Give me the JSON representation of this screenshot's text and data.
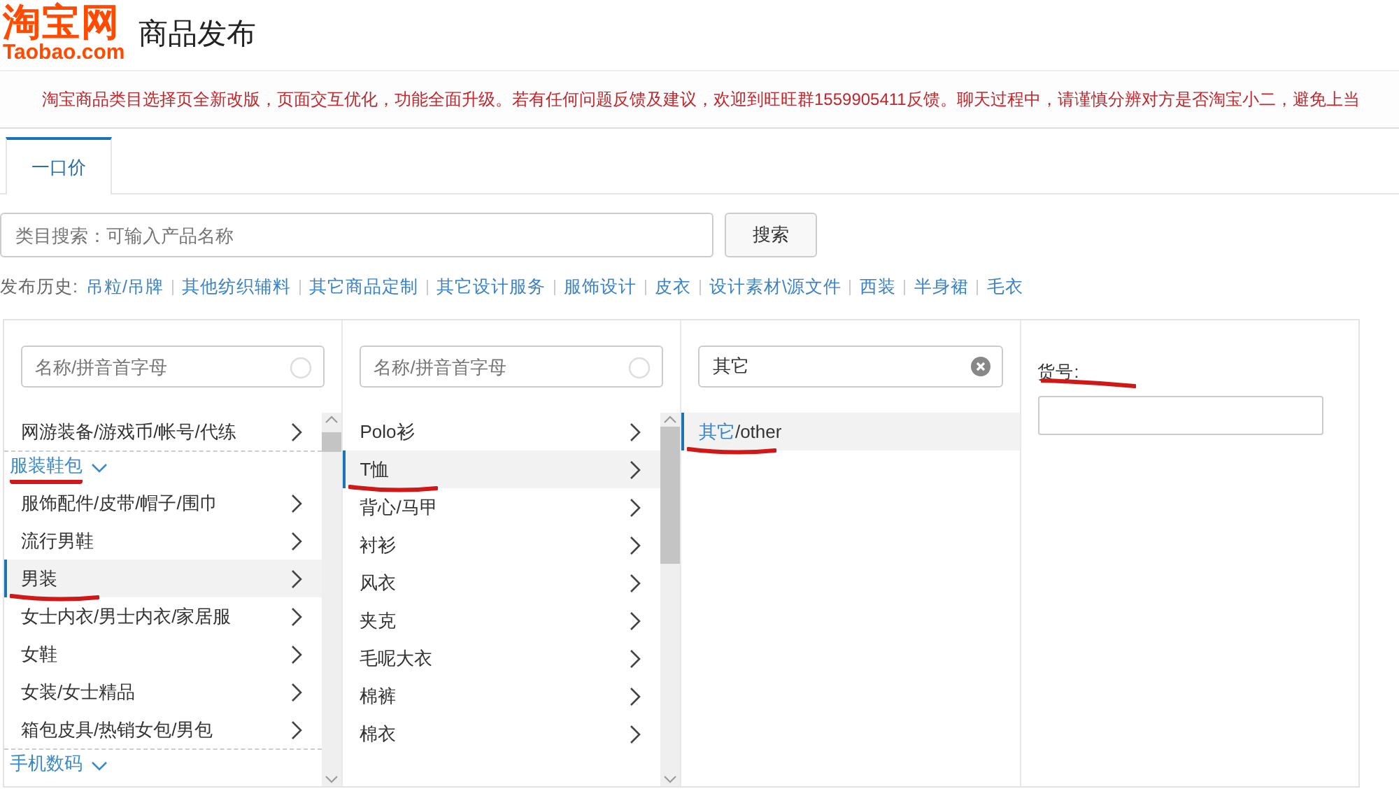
{
  "logo": {
    "mark": "淘宝网",
    "domain": "Taobao.com"
  },
  "page_title": "商品发布",
  "notice": "淘宝商品类目选择页全新改版，页面交互优化，功能全面升级。若有任何问题反馈及建议，欢迎到旺旺群1559905411反馈。聊天过程中，请谨慎分辨对方是否淘宝小二，避免上当",
  "tabs": [
    {
      "label": "一口价",
      "selected": true
    }
  ],
  "category_search": {
    "placeholder": "类目搜索：可输入产品名称",
    "button": "搜索"
  },
  "history": {
    "label": "发布历史:",
    "links": [
      "吊粒/吊牌",
      "其他纺织辅料",
      "其它商品定制",
      "其它设计服务",
      "服饰设计",
      "皮衣",
      "设计素材\\源文件",
      "西装",
      "半身裙",
      "毛衣"
    ]
  },
  "category_columns": [
    {
      "search": {
        "placeholder": "名称/拼音首字母"
      },
      "items": [
        {
          "kind": "item",
          "label": "网游装备/游戏币/帐号/代练",
          "selected": false,
          "annotated": false
        },
        {
          "kind": "group",
          "label": "服装鞋包",
          "annotated": true
        },
        {
          "kind": "item",
          "label": "服饰配件/皮带/帽子/围巾",
          "selected": false,
          "annotated": false
        },
        {
          "kind": "item",
          "label": "流行男鞋",
          "selected": false,
          "annotated": false
        },
        {
          "kind": "item",
          "label": "男装",
          "selected": true,
          "annotated": true
        },
        {
          "kind": "item",
          "label": "女士内衣/男士内衣/家居服",
          "selected": false,
          "annotated": false
        },
        {
          "kind": "item",
          "label": "女鞋",
          "selected": false,
          "annotated": false
        },
        {
          "kind": "item",
          "label": "女装/女士精品",
          "selected": false,
          "annotated": false
        },
        {
          "kind": "item",
          "label": "箱包皮具/热销女包/男包",
          "selected": false,
          "annotated": false
        },
        {
          "kind": "group",
          "label": "手机数码",
          "annotated": false
        }
      ]
    },
    {
      "search": {
        "placeholder": "名称/拼音首字母"
      },
      "items": [
        {
          "kind": "item",
          "label": "Polo衫",
          "selected": false,
          "annotated": false
        },
        {
          "kind": "item",
          "label": "T恤",
          "selected": true,
          "annotated": true
        },
        {
          "kind": "item",
          "label": "背心/马甲",
          "selected": false,
          "annotated": false
        },
        {
          "kind": "item",
          "label": "衬衫",
          "selected": false,
          "annotated": false
        },
        {
          "kind": "item",
          "label": "风衣",
          "selected": false,
          "annotated": false
        },
        {
          "kind": "item",
          "label": "夹克",
          "selected": false,
          "annotated": false
        },
        {
          "kind": "item",
          "label": "毛呢大衣",
          "selected": false,
          "annotated": false
        },
        {
          "kind": "item",
          "label": "棉裤",
          "selected": false,
          "annotated": false
        },
        {
          "kind": "item",
          "label": "棉衣",
          "selected": false,
          "annotated": false
        }
      ]
    },
    {
      "search": {
        "value": "其它"
      },
      "items": [
        {
          "kind": "match",
          "label": "其它",
          "rest": "/other",
          "selected": true,
          "annotated": true
        }
      ]
    }
  ],
  "attribute": {
    "label": "货号:",
    "annotated": true
  }
}
